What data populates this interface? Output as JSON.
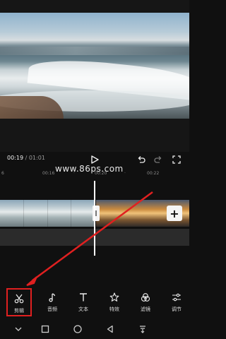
{
  "player": {
    "current_time": "00:19",
    "separator": " / ",
    "total_time": "01:01"
  },
  "ruler": {
    "ticks": [
      "6",
      "00:16",
      "·",
      "00:20",
      "·",
      "00:22"
    ]
  },
  "watermark": "www.86ps.com",
  "timeline": {
    "add_label": "+"
  },
  "toolbar": {
    "tools": [
      {
        "label": "剪辑",
        "icon": "scissors-icon"
      },
      {
        "label": "音频",
        "icon": "music-note-icon"
      },
      {
        "label": "文本",
        "icon": "text-icon"
      },
      {
        "label": "特效",
        "icon": "effects-star-icon"
      },
      {
        "label": "滤镜",
        "icon": "filter-icon"
      },
      {
        "label": "调节",
        "icon": "adjust-sliders-icon"
      }
    ],
    "selected_index": 0
  },
  "colors": {
    "highlight": "#e02020",
    "background": "#101010"
  }
}
